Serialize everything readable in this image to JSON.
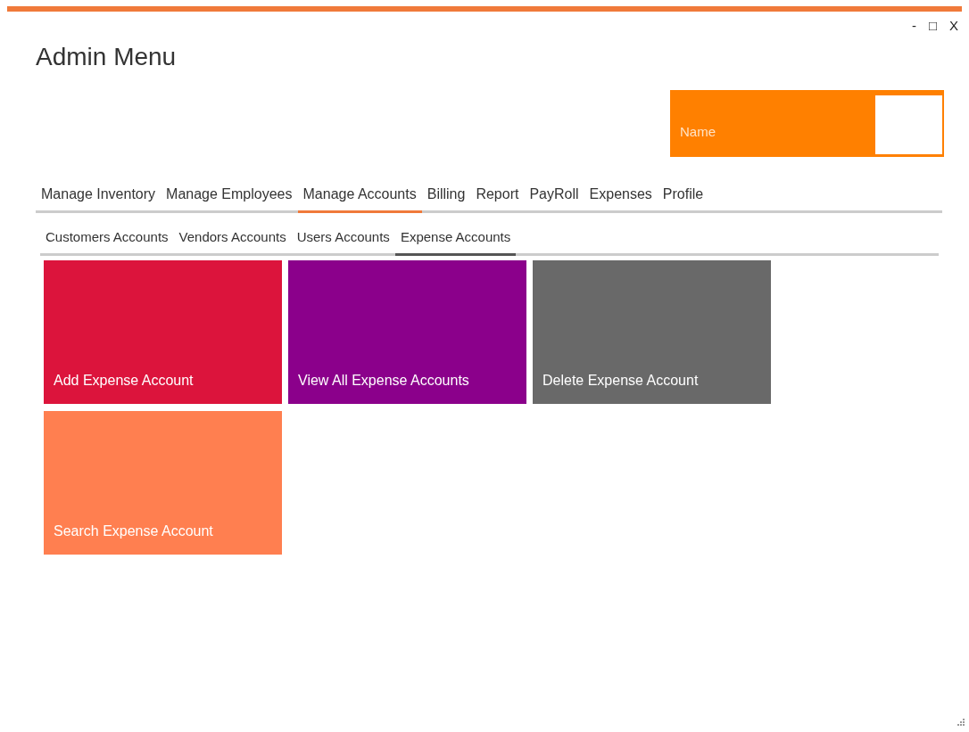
{
  "window": {
    "title": "Admin Menu",
    "controls": [
      "-",
      "□",
      "X"
    ]
  },
  "name_panel": {
    "label": "Name"
  },
  "tabs": [
    {
      "label": "Manage Inventory",
      "selected": false
    },
    {
      "label": "Manage Employees",
      "selected": false
    },
    {
      "label": "Manage Accounts",
      "selected": true
    },
    {
      "label": "Billing",
      "selected": false
    },
    {
      "label": "Report",
      "selected": false
    },
    {
      "label": "PayRoll",
      "selected": false
    },
    {
      "label": "Expenses",
      "selected": false
    },
    {
      "label": "Profile",
      "selected": false
    }
  ],
  "subtabs": [
    {
      "label": "Customers Accounts",
      "selected": false
    },
    {
      "label": "Vendors Accounts",
      "selected": false
    },
    {
      "label": "Users Accounts",
      "selected": false
    },
    {
      "label": "Expense Accounts",
      "selected": true
    }
  ],
  "tiles": [
    {
      "label": "Add Expense Account",
      "color": "#dc143c"
    },
    {
      "label": "View All Expense Accounts",
      "color": "#8b008b"
    },
    {
      "label": "Delete Expense Account",
      "color": "#696969"
    },
    {
      "label": "Search Expense Account",
      "color": "#ff7f50"
    }
  ]
}
